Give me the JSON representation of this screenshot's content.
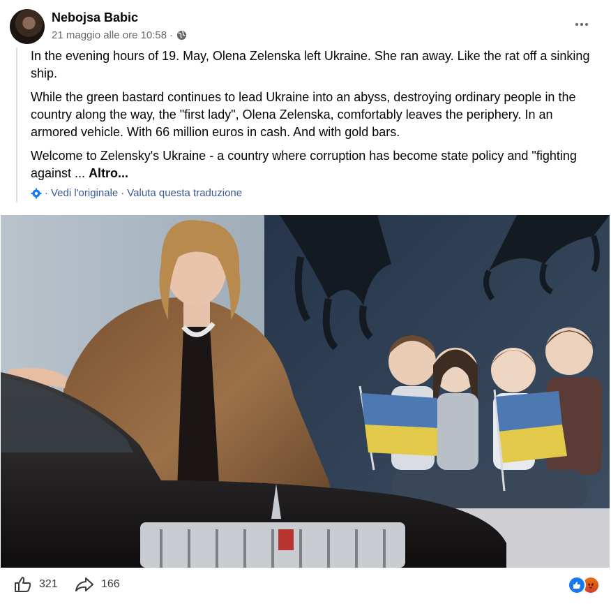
{
  "post": {
    "author": "Nebojsa Babic",
    "date": "21 maggio alle ore 10:58 ·",
    "privacy_icon": "globe-icon",
    "menu_icon": "more-options-icon",
    "paragraphs": [
      "In the evening hours of 19. May, Olena Zelenska left Ukraine. She ran away. Like the rat off a sinking ship.",
      "While the green bastard continues to lead Ukraine into an abyss, destroying ordinary people in the country along the way, the \"first lady\", Olena Zelenska, comfortably leaves the periphery. In an armored vehicle. With 66 million euros in cash. And with gold bars.",
      "Welcome to Zelensky's Ukraine - a country where corruption has become state policy and \"fighting against ... "
    ],
    "more_label": "Altro...",
    "translation": {
      "separator": "·",
      "view_original": "Vedi l'originale",
      "rate_translation": "Valuta questa traduzione"
    }
  },
  "footer": {
    "like_count": "321",
    "share_count": "166",
    "reaction_icons": [
      "like-reaction-icon",
      "angry-reaction-icon"
    ]
  },
  "colors": {
    "link": "#385898",
    "meta": "#65676b",
    "like_blue": "#1877f2"
  }
}
